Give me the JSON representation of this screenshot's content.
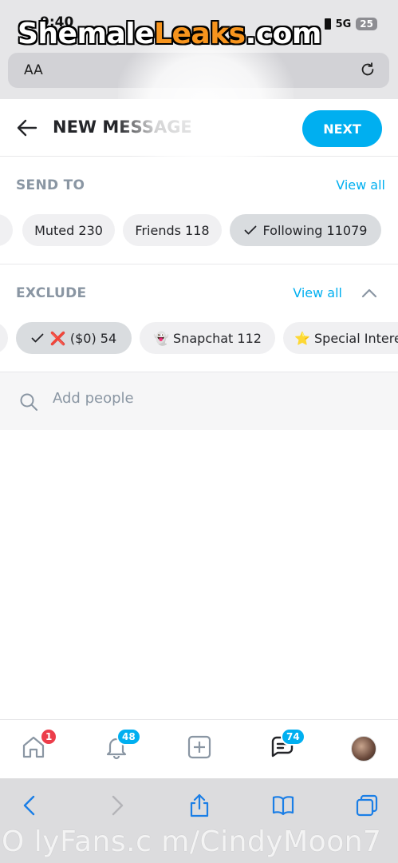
{
  "status_bar": {
    "time": "9:40",
    "network": "5G",
    "battery": "25"
  },
  "watermark": {
    "part1": "Shemale",
    "part2": "Leaks",
    "part3": ".com"
  },
  "browser": {
    "text_size_label": "AA"
  },
  "header": {
    "title": "NEW MESSAGE",
    "next_label": "NEXT"
  },
  "send_to": {
    "label": "SEND TO",
    "view_all": "View all",
    "chips": [
      {
        "label": "",
        "selected": false
      },
      {
        "label": "Muted 230",
        "selected": false
      },
      {
        "label": "Friends 118",
        "selected": false
      },
      {
        "label": "Following 11079",
        "selected": true
      }
    ]
  },
  "exclude": {
    "label": "EXCLUDE",
    "view_all": "View all",
    "chips": [
      {
        "label": "",
        "selected": false
      },
      {
        "label": "❌ ($0) 54",
        "selected": true
      },
      {
        "label": "👻 Snapchat 112",
        "selected": false
      },
      {
        "label": "⭐ Special Interest",
        "selected": false
      }
    ]
  },
  "search": {
    "placeholder": "Add people"
  },
  "bottom_nav": {
    "home_badge": "1",
    "notifications_badge": "48",
    "messages_badge": "74"
  },
  "footer_watermark": "O lyFans.c m/CindyMoon7",
  "colors": {
    "accent": "#00aff0",
    "badge_red": "#ec3d4a",
    "muted_text": "#8a96a3",
    "ios_blue": "#1a7ee6"
  }
}
